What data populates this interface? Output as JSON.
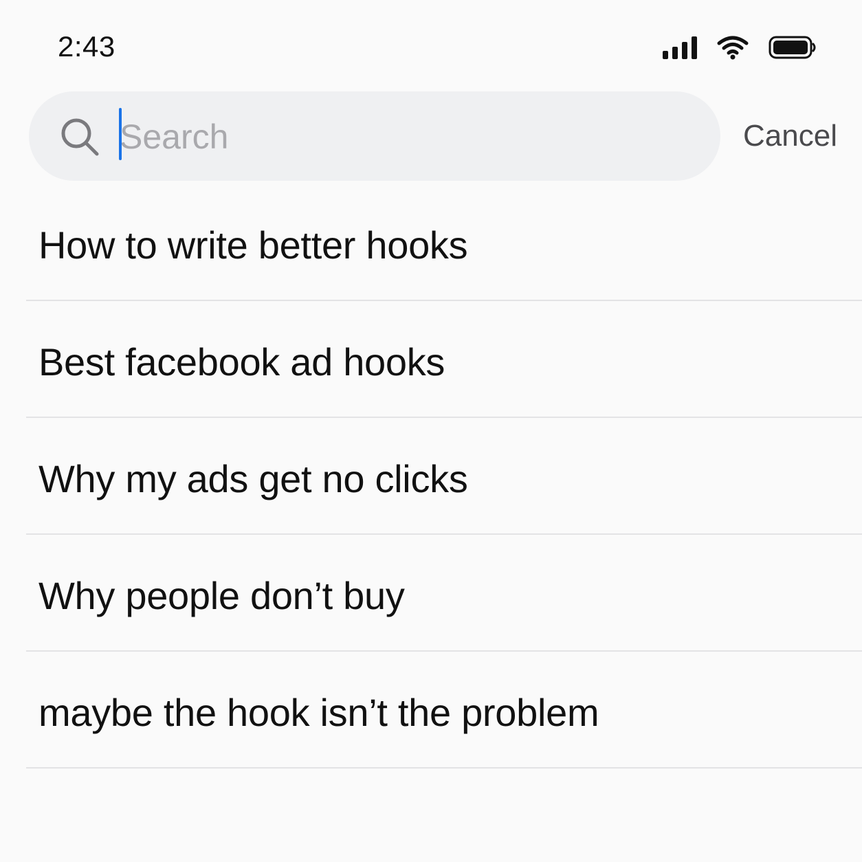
{
  "status_bar": {
    "time": "2:43",
    "icons": [
      "signal-icon",
      "wifi-icon",
      "battery-icon"
    ]
  },
  "search": {
    "value": "",
    "placeholder": "Search",
    "icon": "search-icon",
    "caret_color": "#1a73e8",
    "cancel_label": "Cancel"
  },
  "suggestions": [
    {
      "label": "How to write better hooks"
    },
    {
      "label": "Best facebook ad hooks"
    },
    {
      "label": "Why my ads get no clicks"
    },
    {
      "label": "Why people don’t buy"
    },
    {
      "label": "maybe the hook isn’t the problem"
    }
  ]
}
